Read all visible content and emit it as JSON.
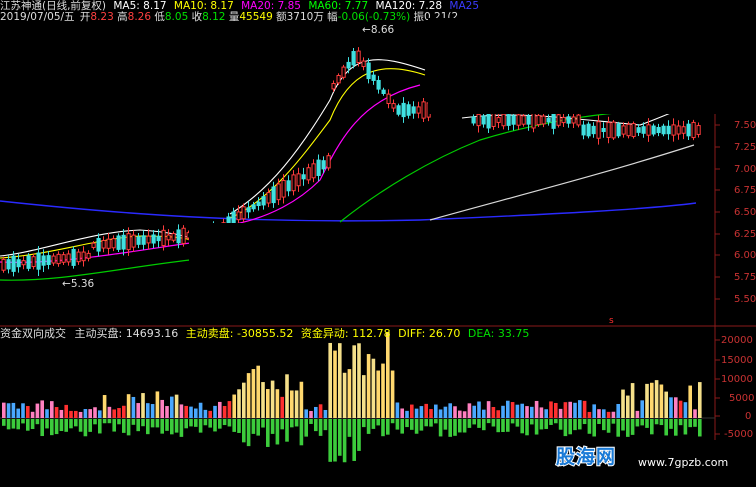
{
  "header": {
    "stock_title": "江苏神通(日线,前复权)",
    "ma5": {
      "label": "MA5: 8.17",
      "color": "#ffffff"
    },
    "ma10": {
      "label": "MA10: 8.17",
      "color": "#ffff00"
    },
    "ma20": {
      "label": "MA20: 7.85",
      "color": "#ff00ff"
    },
    "ma60": {
      "label": "MA60: 7.77",
      "color": "#00ff00"
    },
    "ma120": {
      "label": "MA120: 7.28",
      "color": "#ffffff"
    },
    "ma250": {
      "label": "MA25",
      "color": "#3a3aff"
    }
  },
  "info_bar": {
    "date": "2019/07/05/五",
    "open_label": "开",
    "open": "8.23",
    "high_label": "高",
    "high": "8.26",
    "low_label": "低",
    "low": "8.05",
    "close_label": "收",
    "close": "8.12",
    "volume_label": "量",
    "volume": "45549",
    "amount_label": "额",
    "amount": "3710万",
    "change_label": "幅",
    "change": "-0.06(-0.73%)",
    "amplitude_label": "振",
    "amplitude": "0.21(2"
  },
  "price_axis": [
    "7.50",
    "7.25",
    "7.00",
    "6.75",
    "6.50",
    "6.25",
    "6.00",
    "5.75",
    "5.50"
  ],
  "annotations": {
    "high_mark": "8.66",
    "low_mark": "5.36",
    "marker": "s"
  },
  "indicator": {
    "title": "资金双向成交",
    "buy_label": "主动买盘:",
    "buy_value": "14693.16",
    "sell_label": "主动卖盘:",
    "sell_value": "-30855.52",
    "flow_label": "资金异动:",
    "flow_value": "112.78",
    "diff_label": "DIFF:",
    "diff_value": "26.70",
    "dea_label": "DEA:",
    "dea_value": "33.75"
  },
  "volume_axis": [
    "20000",
    "15000",
    "10000",
    "5000",
    "0",
    "-5000"
  ],
  "watermark": {
    "logo": "股海网",
    "url": "www.7gpzb.com"
  }
}
